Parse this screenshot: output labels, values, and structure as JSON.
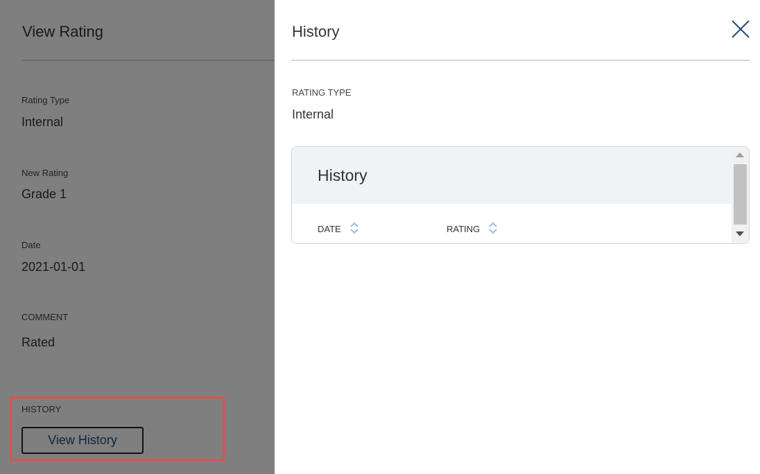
{
  "view_rating": {
    "title": "View Rating",
    "fields": [
      {
        "label": "Rating Type",
        "value": "Internal"
      },
      {
        "label": "New Rating",
        "value": "Grade 1"
      },
      {
        "label": "Date",
        "value": "2021-01-01"
      },
      {
        "label": "COMMENT",
        "value": "Rated"
      }
    ],
    "history_label": "HISTORY",
    "view_history_button": "View History"
  },
  "drawer": {
    "title": "History",
    "rating_type_label": "RATING TYPE",
    "rating_type_value": "Internal",
    "card": {
      "title": "History",
      "columns": [
        "DATE",
        "RATING"
      ]
    }
  },
  "colors": {
    "accent": "#1f4e79",
    "highlight": "#e05050",
    "card_header_bg": "#f0f3f6",
    "sort_icon": "#9bbcd6"
  }
}
